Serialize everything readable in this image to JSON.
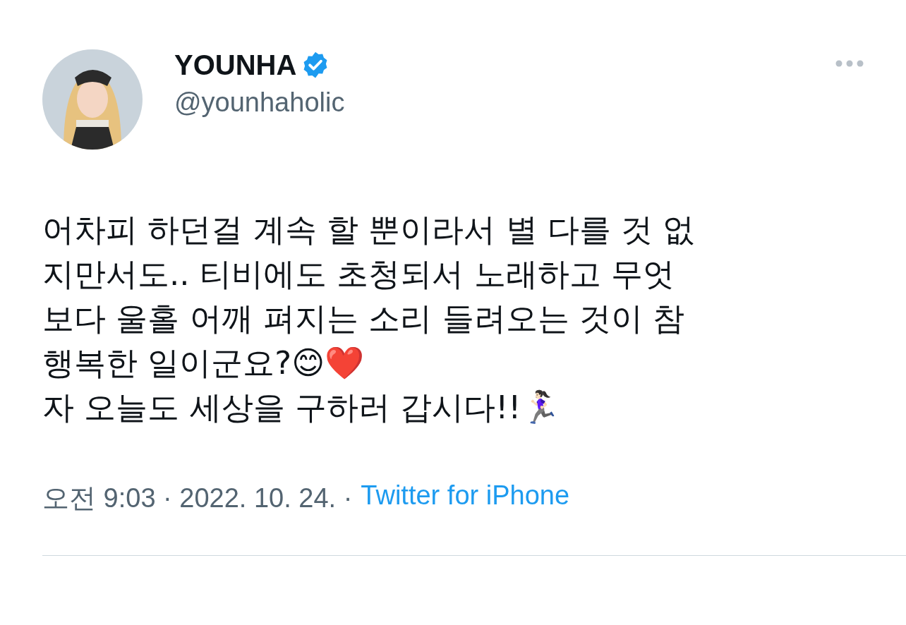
{
  "author": {
    "name": "YOUNHA",
    "verified": true,
    "handle": "@younhaholic"
  },
  "tweet": {
    "lines": [
      "어차피 하던걸 계속 할 뿐이라서 별 다를 것 없",
      "지만서도.. 티비에도 초청되서 노래하고 무엇",
      "보다 울홀 어깨 펴지는 소리 들려오는 것이 참",
      "행복한 일이군요?😊❤️",
      "자 오늘도 세상을 구하러 갑시다!!🏃🏻‍♀️"
    ]
  },
  "footer": {
    "timestamp": "오전 9:03 · 2022. 10. 24. ·",
    "source": "Twitter for iPhone"
  }
}
